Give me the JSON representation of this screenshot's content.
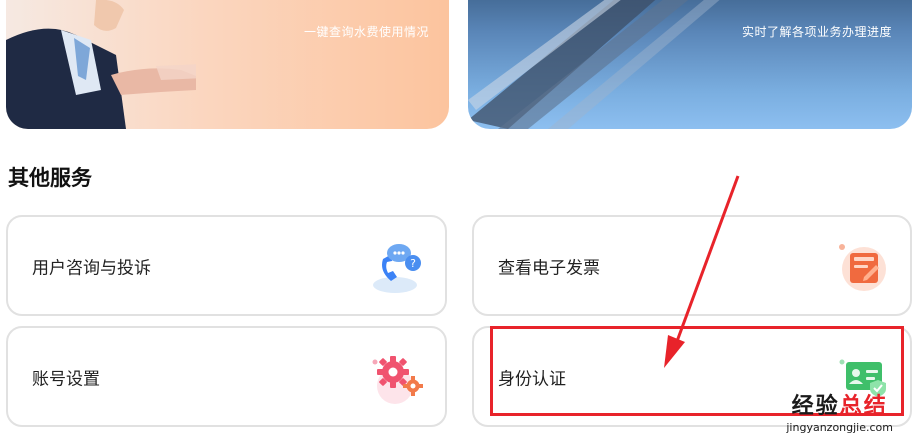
{
  "banners": [
    {
      "caption": "一键查询水费使用情况"
    },
    {
      "caption": "实时了解各项业务办理进度"
    }
  ],
  "section": {
    "title": "其他服务"
  },
  "services": [
    {
      "label": "用户咨询与投诉",
      "icon": "customer-service-icon"
    },
    {
      "label": "查看电子发票",
      "icon": "invoice-icon"
    },
    {
      "label": "账号设置",
      "icon": "settings-gear-icon"
    },
    {
      "label": "身份认证",
      "icon": "id-card-icon"
    }
  ],
  "watermark": {
    "title_a": "经验",
    "title_b": "总结",
    "url": "jingyanzongjie.com"
  },
  "colors": {
    "annotation": "#e8232a",
    "card_border": "#e1e1e1"
  }
}
